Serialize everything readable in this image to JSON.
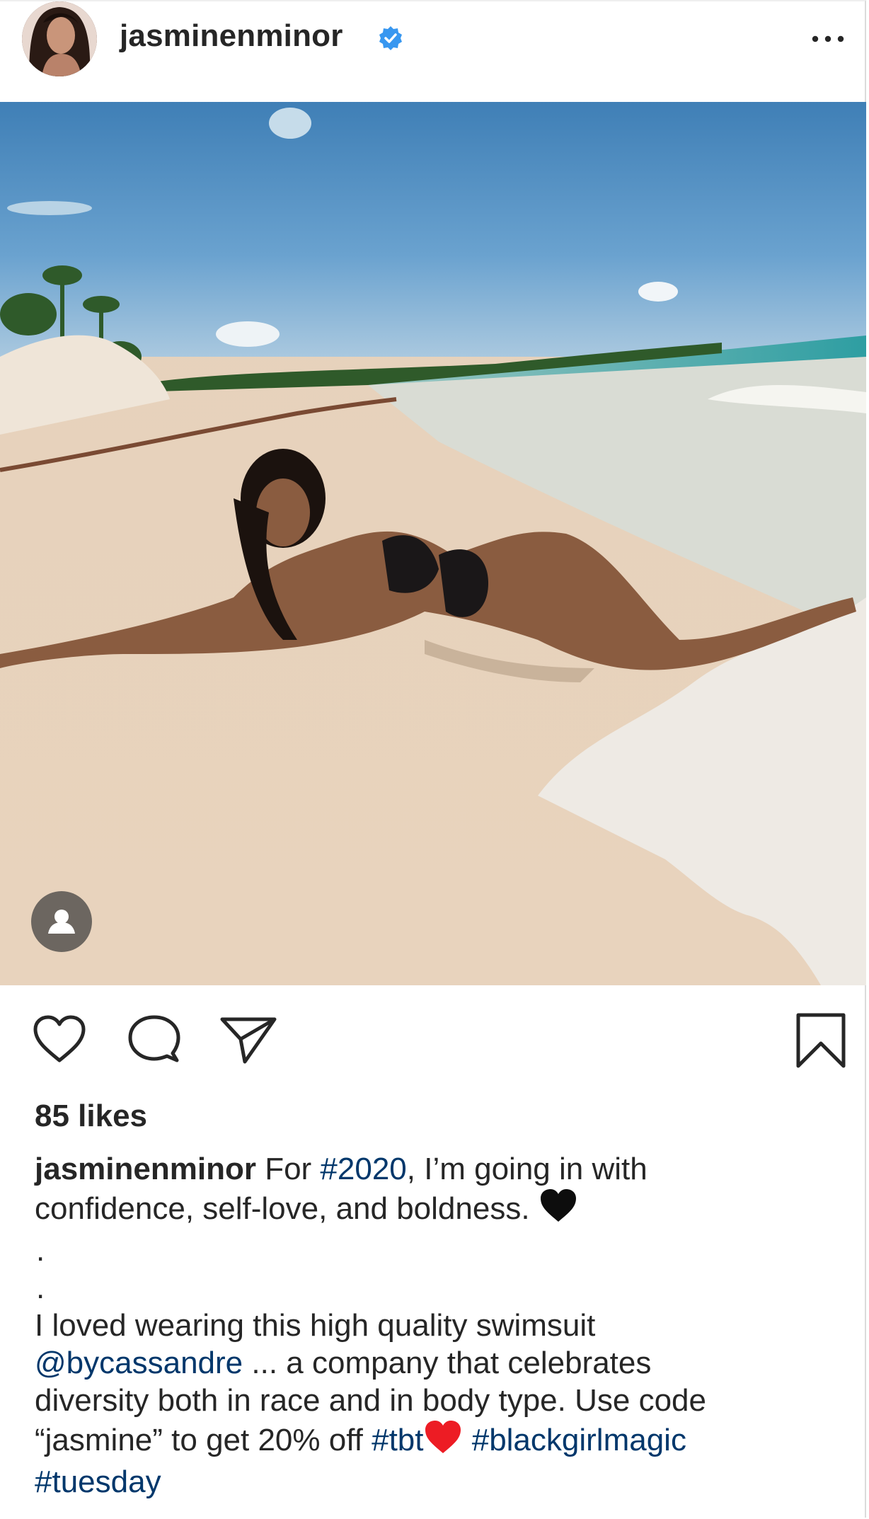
{
  "post": {
    "username": "jasminenminor",
    "verified": true,
    "more_icon": "more-options-icon",
    "photo_alt": "beach-photo",
    "likes_text": "85 likes",
    "caption": {
      "username": "jasminenminor",
      "line1_a": " For ",
      "tag_2020": "#2020",
      "line1_b": ", I’m going in with",
      "line2": "confidence, self-love, and boldness. ",
      "dot1": ".",
      "dot2": ".",
      "line5": "I loved wearing this high quality swimsuit",
      "mention": "@bycassandre",
      "line6_b": " ... a company that celebrates",
      "line7": "diversity both in race and in body type. Use code",
      "line8_a": "“jasmine” to get 20% off ",
      "tag_tbt": "#tbt",
      "tag_bgm": "#blackgirlmagic",
      "tag_tuesday": "#tuesday"
    }
  },
  "colors": {
    "text": "#262626",
    "link": "#00376b",
    "verified": "#3897f0",
    "heart_red": "#ed1c24"
  }
}
